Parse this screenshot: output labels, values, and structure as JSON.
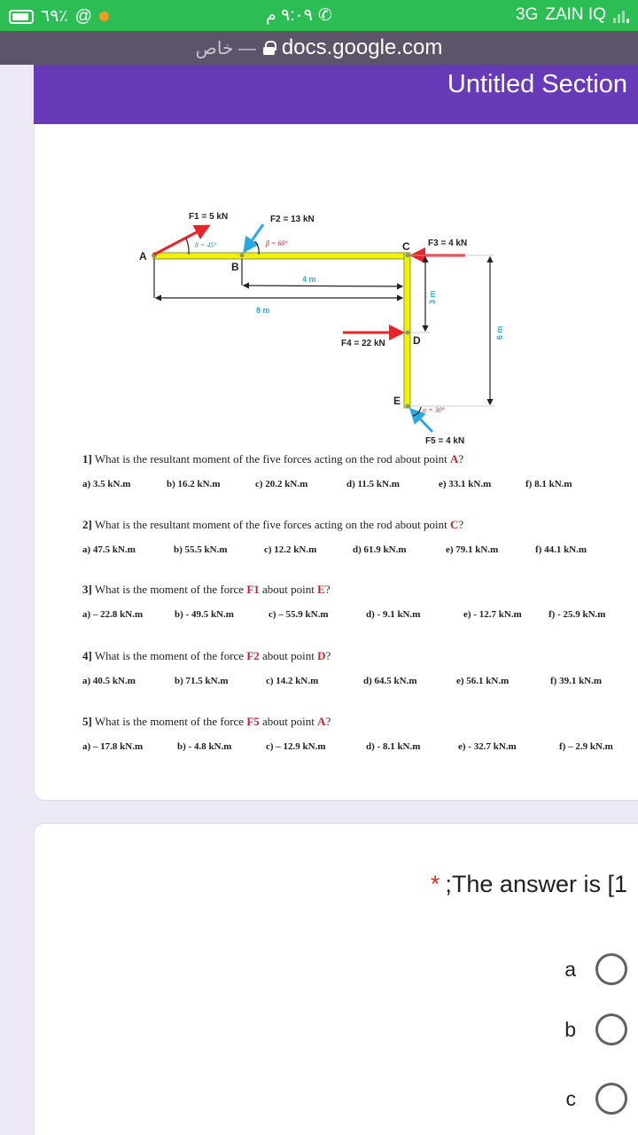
{
  "status_bar": {
    "battery": "٦٩٪",
    "time": "٩:٠٩ م",
    "network": "3G",
    "carrier": "ZAIN IQ"
  },
  "browser": {
    "url": "docs.google.com",
    "mode_label": "خاص —"
  },
  "form": {
    "section_title": "Untitled Section",
    "diagram": {
      "labels": {
        "f1": "F1 = 5 kN",
        "f2": "F2 = 13 kN",
        "f3": "F3 = 4 kN",
        "f4": "F4 = 22 kN",
        "f5": "F5 = 4 kN",
        "theta": "θ = 45°",
        "beta": "β = 60°",
        "alpha": "α = 30°",
        "dim_4m": "4 m",
        "dim_8m": "8 m",
        "dim_3m": "3 m",
        "dim_6m": "6 m",
        "point_a": "A",
        "point_b": "B",
        "point_c": "C",
        "point_d": "D",
        "point_e": "E"
      }
    },
    "questions": [
      {
        "number": "1]",
        "text_before": " What is the resultant moment of the five forces acting on the rod about point ",
        "highlight1": "",
        "text_mid": "",
        "highlight2": "A",
        "text_after": "?",
        "options": [
          "a) 3.5 kN.m",
          "b) 16.2 kN.m",
          "c) 20.2 kN.m",
          "d) 11.5 kN.m",
          "e) 33.1 kN.m",
          "f) 8.1 kN.m"
        ]
      },
      {
        "number": "2]",
        "text_before": " What is the resultant moment of the five forces acting on the rod about point ",
        "highlight1": "",
        "text_mid": "",
        "highlight2": "C",
        "text_after": "?",
        "options": [
          "a) 47.5 kN.m",
          "b) 55.5 kN.m",
          "c) 12.2 kN.m",
          "d) 61.9 kN.m",
          "e) 79.1 kN.m",
          "f) 44.1 kN.m"
        ]
      },
      {
        "number": "3]",
        "text_before": " What is the moment of the force ",
        "highlight1": "F1",
        "text_mid": " about point ",
        "highlight2": "E",
        "text_after": "?",
        "options": [
          "a) – 22.8 kN.m",
          "b) - 49.5 kN.m",
          "c) – 55.9 kN.m",
          "d) - 9.1 kN.m",
          "e) - 12.7 kN.m",
          "f) - 25.9 kN.m"
        ]
      },
      {
        "number": "4]",
        "text_before": " What is the moment of the force ",
        "highlight1": "F2",
        "text_mid": " about point ",
        "highlight2": "D",
        "text_after": "?",
        "options": [
          "a) 40.5 kN.m",
          "b) 71.5 kN.m",
          "c) 14.2 kN.m",
          "d) 64.5 kN.m",
          "e) 56.1 kN.m",
          "f) 39.1 kN.m"
        ]
      },
      {
        "number": "5]",
        "text_before": " What is the moment of the force ",
        "highlight1": "F5",
        "text_mid": " about point ",
        "highlight2": "A",
        "text_after": "?",
        "options": [
          "a) – 17.8 kN.m",
          "b) - 4.8 kN.m",
          "c) – 12.9 kN.m",
          "d) - 8.1 kN.m",
          "e) - 32.7 kN.m",
          "f) – 2.9 kN.m"
        ]
      }
    ],
    "answer_question": {
      "required_mark": "*",
      "title": ";The answer is [1",
      "choices": [
        "a",
        "b",
        "c"
      ]
    }
  },
  "colors": {
    "status_bar": "#2dbd55",
    "url_bar": "#5c5469",
    "form_accent": "#673ab7",
    "background": "#ede9f6",
    "highlight_red": "#c0262d",
    "rod_yellow": "#f5f200"
  }
}
